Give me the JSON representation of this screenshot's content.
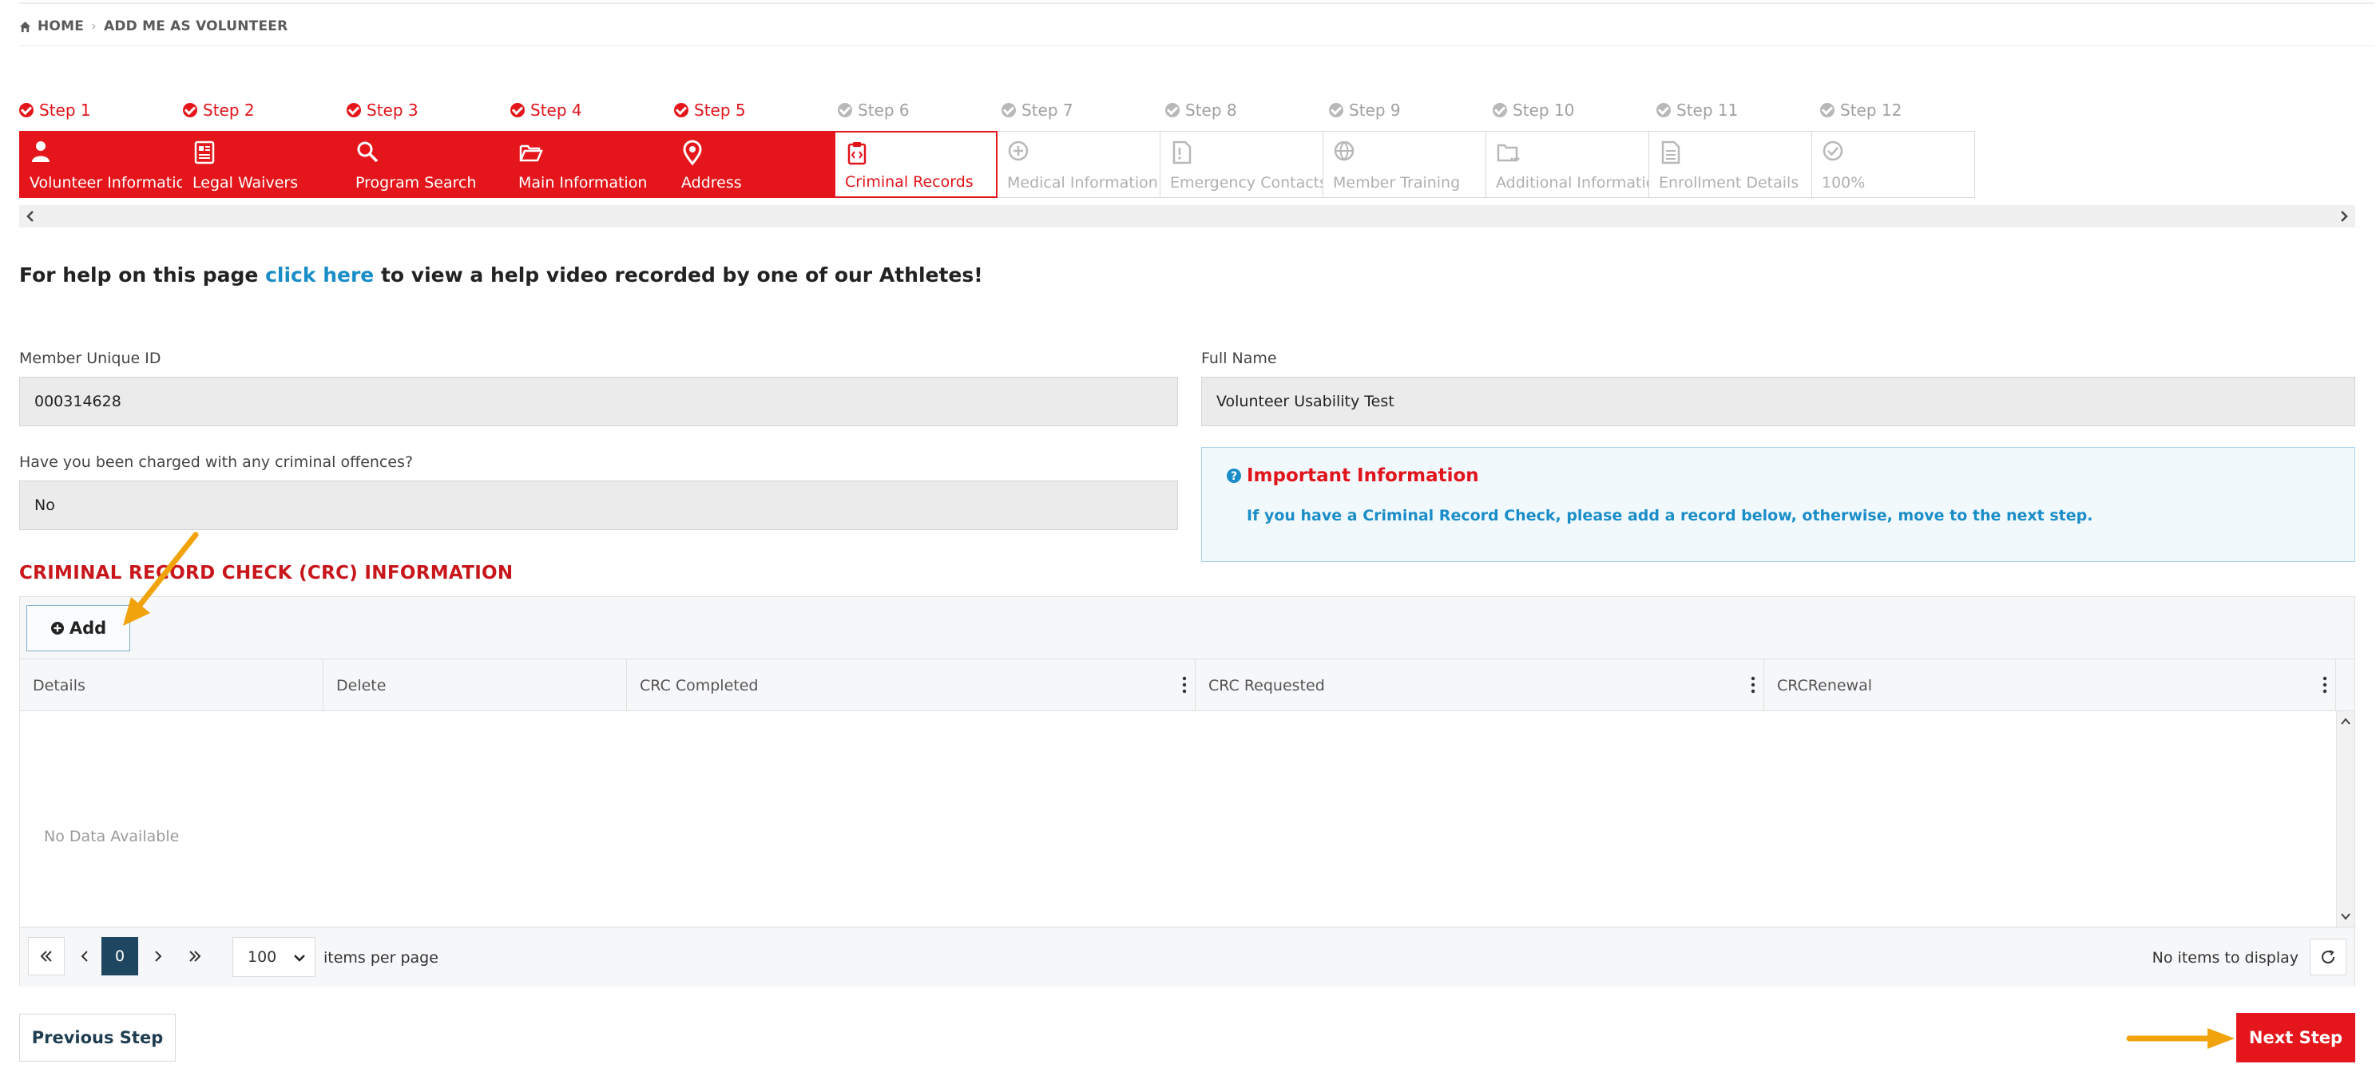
{
  "breadcrumb": {
    "home": "HOME",
    "current": "ADD ME AS VOLUNTEER"
  },
  "wizard": {
    "steps": [
      {
        "step": "Step 1",
        "label": "Volunteer Information",
        "state": "done",
        "icon": "person-icon"
      },
      {
        "step": "Step 2",
        "label": "Legal Waivers",
        "state": "done",
        "icon": "document-list-icon"
      },
      {
        "step": "Step 3",
        "label": "Program Search",
        "state": "done",
        "icon": "search-icon"
      },
      {
        "step": "Step 4",
        "label": "Main Information",
        "state": "done",
        "icon": "folder-open-icon"
      },
      {
        "step": "Step 5",
        "label": "Address",
        "state": "done",
        "icon": "map-pin-icon"
      },
      {
        "step": "Step 6",
        "label": "Criminal Records",
        "state": "current",
        "icon": "clipboard-code-icon"
      },
      {
        "step": "Step 7",
        "label": "Medical Information",
        "state": "todo",
        "icon": "plus-circle-icon"
      },
      {
        "step": "Step 8",
        "label": "Emergency Contacts",
        "state": "todo",
        "icon": "alert-file-icon"
      },
      {
        "step": "Step 9",
        "label": "Member Training",
        "state": "todo",
        "icon": "basketball-icon"
      },
      {
        "step": "Step 10",
        "label": "Additional Information",
        "state": "todo",
        "icon": "folder-dots-icon"
      },
      {
        "step": "Step 11",
        "label": "Enrollment Details",
        "state": "todo",
        "icon": "file-text-icon"
      },
      {
        "step": "Step 12",
        "label": "100%",
        "state": "todo",
        "icon": "check-circle-icon"
      }
    ]
  },
  "help": {
    "before": "For help on this page ",
    "link": "click here",
    "after": " to view a help video recorded by one of our Athletes!"
  },
  "form": {
    "member_id_label": "Member Unique ID",
    "member_id_value": "000314628",
    "full_name_label": "Full Name",
    "full_name_value": "Volunteer Usability Test",
    "charged_label": "Have you been charged with any criminal offences?",
    "charged_value": "No"
  },
  "info": {
    "title": "Important Information",
    "text": "If you have a Criminal Record Check, please add a record below, otherwise, move to the next step."
  },
  "section_title": "CRIMINAL RECORD CHECK (CRC) INFORMATION",
  "grid": {
    "add_label": "Add",
    "columns": [
      "Details",
      "Delete",
      "CRC Completed",
      "CRC Requested",
      "CRCRenewal"
    ],
    "empty_text": "No Data Available",
    "pager": {
      "page": "0",
      "page_size": "100",
      "per_page_label": "items per page",
      "info": "No items to display"
    }
  },
  "buttons": {
    "previous": "Previous Step",
    "next": "Next Step"
  },
  "colors": {
    "accent": "#e4161b",
    "link": "#1a8dc8",
    "annotation": "#f0a30a"
  }
}
